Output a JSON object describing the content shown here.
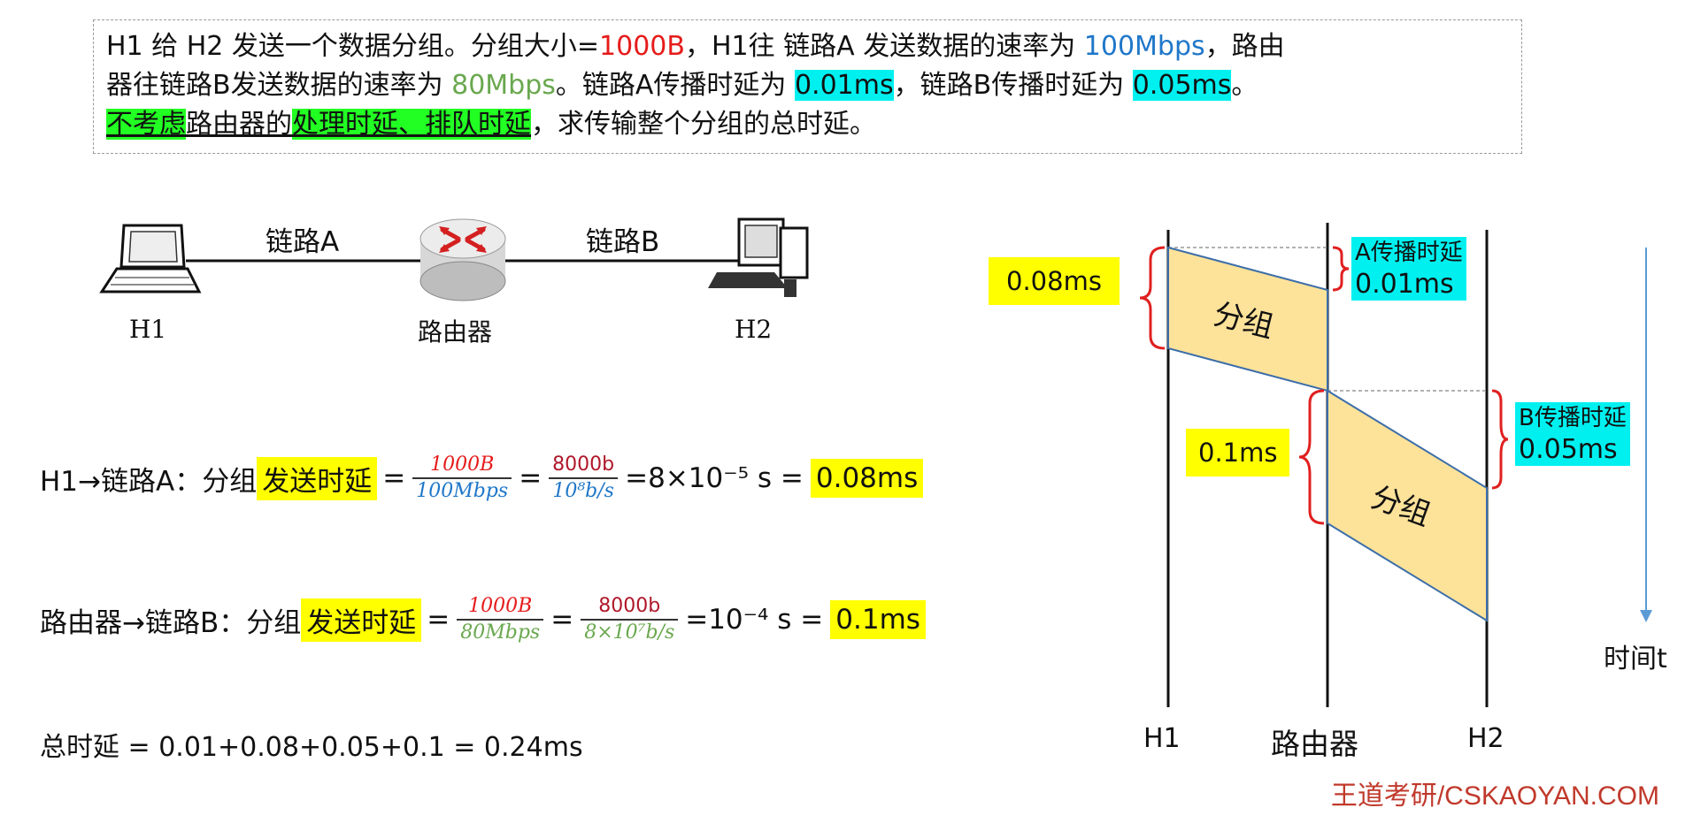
{
  "problem": {
    "p1": "H1 给 H2 发送一个数据分组。分组大小=",
    "size": "1000B",
    "p2": "，H1往 链路A 发送数据的速率为 ",
    "rateA": "100Mbps",
    "p3": "，路由",
    "p4": "器往链路B发送数据的速率为 ",
    "rateB": "80Mbps",
    "p5": "。链路A传播时延为 ",
    "propA": "0.01ms",
    "p6": "，链路B传播时延为 ",
    "propB": "0.05ms",
    "p7": "。",
    "no_consider": "不考虑",
    "router_of": "路由器的",
    "delays": "处理时延、排队时延",
    "p8": "，求传输整个分组的总时延。"
  },
  "network": {
    "linkA": "链路A",
    "linkB": "链路B",
    "h1": "H1",
    "router": "路由器",
    "h2": "H2"
  },
  "eq1": {
    "prefix": "H1→链路A：分组",
    "highlight": "发送时延",
    "eq": "=",
    "num1": "1000B",
    "den1": "100Mbps",
    "num2": "8000b",
    "den2": "10⁸b/s",
    "mid": "=8×10⁻⁵ s =",
    "result": "0.08ms"
  },
  "eq2": {
    "prefix": "路由器→链路B：分组",
    "highlight": "发送时延",
    "eq": "=",
    "num1": "1000B",
    "den1": "80Mbps",
    "num2": "8000b",
    "den2": "8×10⁷b/s",
    "mid": "=10⁻⁴ s =",
    "result": "0.1ms"
  },
  "total": "总时延 = 0.01+0.08+0.05+0.1 = 0.24ms",
  "timeline": {
    "trans_a": "0.08ms",
    "prop_a_label": "A传播时延",
    "prop_a": "0.01ms",
    "packet": "分组",
    "trans_b": "0.1ms",
    "prop_b_label": "B传播时延",
    "prop_b": "0.05ms",
    "time_label": "时间t",
    "h1": "H1",
    "router": "路由器",
    "h2": "H2"
  },
  "brand": "王道考研/CSKAOYAN.COM",
  "colors": {
    "red": "#e61b1b",
    "blue": "#1f77c9",
    "green": "#6aa84f",
    "cyan": "#00f0f0",
    "yellow": "#ffff00",
    "packet_fill": "#fde29a"
  }
}
